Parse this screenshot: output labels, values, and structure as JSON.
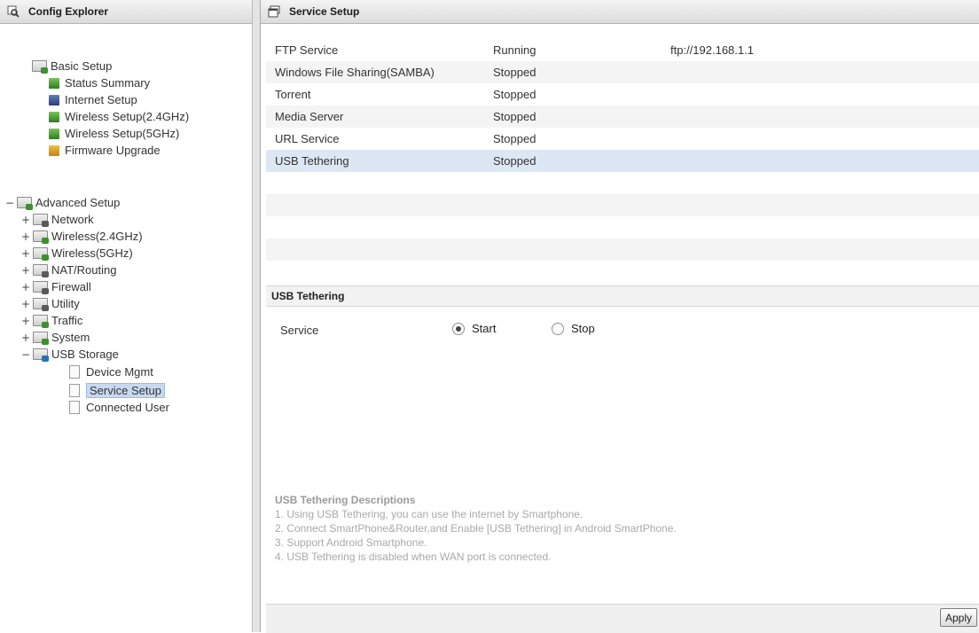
{
  "left_panel": {
    "title": "Config Explorer",
    "basic_setup": {
      "label": "Basic Setup",
      "items": [
        {
          "label": "Status Summary",
          "icon": "chart-icon"
        },
        {
          "label": "Internet Setup",
          "icon": "globe-icon"
        },
        {
          "label": "Wireless Setup(2.4GHz)",
          "icon": "wireless-icon"
        },
        {
          "label": "Wireless Setup(5GHz)",
          "icon": "wireless-icon"
        },
        {
          "label": "Firmware Upgrade",
          "icon": "firmware-icon"
        }
      ]
    },
    "advanced_setup": {
      "label": "Advanced Setup",
      "toggle": "−",
      "items": [
        {
          "label": "Network",
          "toggle": "+"
        },
        {
          "label": "Wireless(2.4GHz)",
          "toggle": "+"
        },
        {
          "label": "Wireless(5GHz)",
          "toggle": "+"
        },
        {
          "label": "NAT/Routing",
          "toggle": "+"
        },
        {
          "label": "Firewall",
          "toggle": "+"
        },
        {
          "label": "Utility",
          "toggle": "+"
        },
        {
          "label": "Traffic",
          "toggle": "+"
        },
        {
          "label": "System",
          "toggle": "+"
        },
        {
          "label": "USB Storage",
          "toggle": "−"
        }
      ],
      "usb_storage_children": [
        {
          "label": "Device Mgmt"
        },
        {
          "label": "Service Setup",
          "selected": true
        },
        {
          "label": "Connected User"
        }
      ]
    }
  },
  "main": {
    "title": "Service Setup",
    "services": [
      {
        "name": "FTP Service",
        "status": "Running",
        "info": "ftp://192.168.1.1"
      },
      {
        "name": "Windows File Sharing(SAMBA)",
        "status": "Stopped",
        "info": ""
      },
      {
        "name": "Torrent",
        "status": "Stopped",
        "info": ""
      },
      {
        "name": "Media Server",
        "status": "Stopped",
        "info": ""
      },
      {
        "name": "URL Service",
        "status": "Stopped",
        "info": ""
      },
      {
        "name": "USB Tethering",
        "status": "Stopped",
        "info": "",
        "selected": true
      }
    ],
    "usb_tethering": {
      "section_title": "USB Tethering",
      "service_label": "Service",
      "options": [
        "Start",
        "Stop"
      ],
      "selected_option": "Start",
      "description_title": "USB Tethering Descriptions",
      "descriptions": [
        "1. Using USB Tethering, you can use the internet by Smartphone.",
        "2. Connect SmartPhone&Router,and Enable [USB Tethering] in Android SmartPhone.",
        "3. Support Android Smartphone.",
        "4. USB Tethering is disabled when WAN port is connected."
      ]
    },
    "apply_label": "Apply"
  },
  "colors": {
    "selection": "#c7d9f1",
    "row_selected": "#dde7f4",
    "description_text": "#a9a9a9"
  }
}
